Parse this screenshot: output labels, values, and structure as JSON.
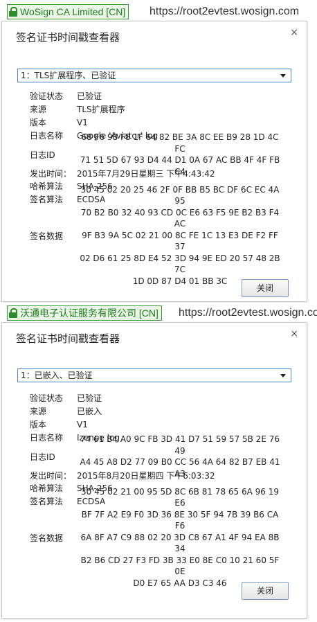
{
  "top": {
    "ev_label": "WoSign CA Limited [CN]",
    "url": "https://root2evtest.wosign.com",
    "dialog": {
      "title": "签名证书时间戳查看器",
      "close": "×",
      "select_value": "1：TLS扩展程序、已验证",
      "fields": {
        "status_label": "验证状态",
        "status": "已验证",
        "source_label": "来源",
        "source": "TLS扩展程序",
        "version_label": "版本",
        "version": "V1",
        "logname_label": "日志名称",
        "logname": "Google 'Aviator' log",
        "logid_label": "日志ID",
        "logid": "68 F6 98 F8 1F 64 82 BE 3A 8C EE B9 28 1D 4C FC\n71 51 5D 67 93 D4 44 D1 0A 67 AC BB 4F 4F FB C4",
        "issued_label": "发出时间：",
        "issued": "2015年7月29日星期三 下午4:43:42",
        "hash_label": "哈希算法",
        "hash": "SHA-256",
        "sigalg_label": "签名算法",
        "sigalg": "ECDSA",
        "sig_label": "签名数据",
        "sig": "30 45 02 20 25 46 2F 0F BB B5 BC DF 6C EC 4A 95\n70 B2 B0 32 40 93 CD 0C E6 63 F5 9E B2 B3 F4 AC\n9F B3 9A 5C 02 21 00 8C FE 1C 13 E3 DE F2 FF 37\n02 D6 61 25 8D E4 52 3D 94 9E ED 20 57 48 2B 7C\n1D 0D 87 D4 01 BB 3C"
      },
      "close_button": "关闭"
    }
  },
  "bottom": {
    "ev_label": "沃通电子认证服务有限公司 [CN]",
    "url": "https://root2evtest.wosign.com",
    "dialog": {
      "title": "签名证书时间戳查看器",
      "close": "×",
      "select_value": "1：已嵌入、已验证",
      "fields": {
        "status_label": "验证状态",
        "status": "已验证",
        "source_label": "来源",
        "source": "已嵌入",
        "version_label": "版本",
        "version": "V1",
        "logname_label": "日志名称",
        "logname": "Izenpe log",
        "logid_label": "日志ID",
        "logid": "74 61 B4 A0 9C FB 3D 41 D7 51 59 57 5B 2E 76 49\nA4 45 A8 D2 77 09 B0 CC 56 4A 64 82 B7 EB 41 A3",
        "issued_label": "发出时间：",
        "issued": "2015年8月20日星期四 下午6:03:32",
        "hash_label": "哈希算法",
        "hash": "SHA-256",
        "sigalg_label": "签名算法",
        "sigalg": "ECDSA",
        "sig_label": "签名数据",
        "sig": "30 45 02 21 00 95 5D 8C 6B 81 78 65 6A 96 19 E6\nBF 7F A2 E9 F0 3D 36 8E 30 5F 94 7B 39 B6 CA F6\n6A 8F A7 C9 88 02 20 3D C8 67 A1 4F 94 EA 8B 34\nB2 B6 CD 27 F3 FD 3B 33 E0 8E C0 10 21 60 5F 0E\nD0 E7 65 AA D3 C3 46"
      },
      "close_button": "关闭"
    }
  }
}
